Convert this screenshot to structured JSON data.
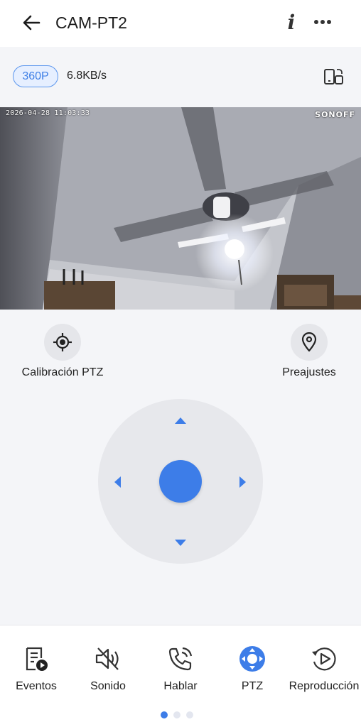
{
  "header": {
    "title": "CAM-PT2",
    "back_icon": "arrow-left-icon",
    "info_icon": "info-icon",
    "more_icon": "more-horizontal-icon"
  },
  "stream": {
    "quality": "360P",
    "bitrate": "6.8KB/s",
    "screen_icon": "rotate-screen-icon"
  },
  "video": {
    "timestamp": "2026-04-28 11:03:33",
    "watermark": "SONOFF"
  },
  "ptz": {
    "calibration_label": "Calibración PTZ",
    "preset_label": "Preajustes",
    "joystick_color": "#3d7de8"
  },
  "bottom_bar": {
    "items": [
      {
        "label": "Eventos",
        "icon": "events-icon"
      },
      {
        "label": "Sonido",
        "icon": "speaker-muted-icon"
      },
      {
        "label": "Hablar",
        "icon": "phone-call-icon"
      },
      {
        "label": "PTZ",
        "icon": "ptz-icon",
        "active": true
      },
      {
        "label": "Reproducción",
        "icon": "playback-icon"
      }
    ],
    "page_count": 3,
    "active_page": 1
  },
  "colors": {
    "accent": "#3d7de8",
    "background": "#f4f5f8"
  }
}
